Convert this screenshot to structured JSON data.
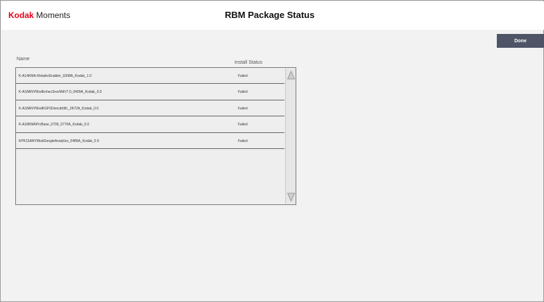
{
  "header": {
    "brand_kodak": "Kodak",
    "brand_moments": "Moments",
    "title": "RBM Package Status"
  },
  "actions": {
    "done_label": "Done"
  },
  "table": {
    "columns": {
      "name": "Name",
      "status": "Install Status"
    },
    "rows": [
      {
        "name": "K-A14KMA-RetailerEnabler_0308A_Kodak_1.0",
        "status": "Failed"
      },
      {
        "name": "K-A18ANYModEnhecSrecMdV7.0_0409A_Kodak_0.0",
        "status": "Failed"
      },
      {
        "name": "K-A18ANYModKGF5DencdrbfiL_0672A_Kodak_0.0",
        "status": "Failed"
      },
      {
        "name": "K-A18KMAPrcBase_0709_0770A_Kodak_0.0",
        "status": "Failed"
      },
      {
        "name": "KPK15ANYModGoogleAnalytics_0486A_Kodak_0.0",
        "status": "Failed"
      }
    ]
  },
  "colors": {
    "brand_red": "#e4001b",
    "done_button_bg": "#4f5566",
    "page_bg": "#f2f2f2"
  },
  "icons": {
    "scroll_up": "triangle-up-icon",
    "scroll_down": "triangle-down-icon"
  }
}
